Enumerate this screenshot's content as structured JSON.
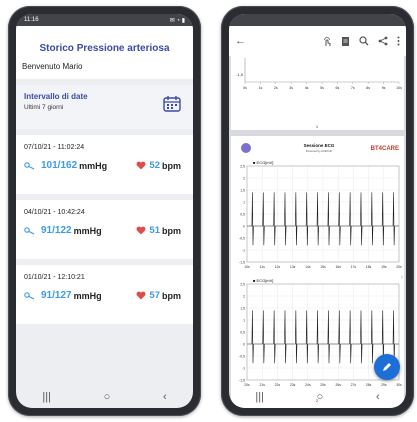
{
  "left": {
    "status": {
      "time": "11:16",
      "icons": "✉ ◔ ▮"
    },
    "title": "Storico Pressione arteriosa",
    "welcome": "Benvenuto Mario",
    "range": {
      "title": "Intervallo di date",
      "subtitle": "Ultimi 7 giorni",
      "icon": "calendar-icon"
    },
    "measures": [
      {
        "date": "07/10/21 - 11:02:24",
        "bp": "101/162",
        "bp_unit": "mmHg",
        "hr": "52",
        "hr_unit": "bpm"
      },
      {
        "date": "04/10/21 - 10:42:24",
        "bp": "91/122",
        "bp_unit": "mmHg",
        "hr": "51",
        "hr_unit": "bpm"
      },
      {
        "date": "01/10/21 - 12:10:21",
        "bp": "91/127",
        "bp_unit": "mmHg",
        "hr": "57",
        "hr_unit": "bpm"
      }
    ],
    "nav": [
      "|||",
      "○",
      "‹"
    ]
  },
  "right": {
    "toolbar": {
      "back": "←",
      "icons": [
        "touch-icon",
        "document-icon",
        "search-icon",
        "share-icon",
        "more-icon"
      ]
    },
    "top_page": {
      "y_tick": "-1,5",
      "x_ticks": [
        "0s",
        "1s",
        "2s",
        "3s",
        "4s",
        "5s",
        "6s",
        "7s",
        "8s",
        "9s",
        "10s"
      ],
      "page_number": "1"
    },
    "report": {
      "title": "Sessione ECG",
      "subtitle": "Powered by ACEToth",
      "brand": "BT4CARE",
      "page_number": "2",
      "side_page_indicator": "1"
    },
    "ecg_charts": [
      {
        "label": "ECG[mV]",
        "y_ticks": [
          "2,5",
          "2",
          "1,5",
          "1",
          "0,5",
          "0",
          "-0,5",
          "-1",
          "-1,5"
        ],
        "x_ticks": [
          "10s",
          "11s",
          "12s",
          "13s",
          "14s",
          "15s",
          "16s",
          "17s",
          "18s",
          "19s",
          "20s"
        ],
        "beats": 14
      },
      {
        "label": "ECG[mV]",
        "y_ticks": [
          "2,5",
          "2",
          "1,5",
          "1",
          "0,5",
          "0",
          "-0,5",
          "-1",
          "-1,5"
        ],
        "x_ticks": [
          "20s",
          "21s",
          "22s",
          "23s",
          "24s",
          "25s",
          "26s",
          "27s",
          "28s",
          "29s",
          "30s"
        ],
        "beats": 14
      }
    ],
    "fab_icon": "edit-icon",
    "nav": [
      "|||",
      "○",
      "‹"
    ]
  },
  "colors": {
    "accent": "#3b4aa8",
    "value_blue": "#3d9be6",
    "heart_red": "#e24b4b",
    "fab": "#1d6fd6"
  }
}
